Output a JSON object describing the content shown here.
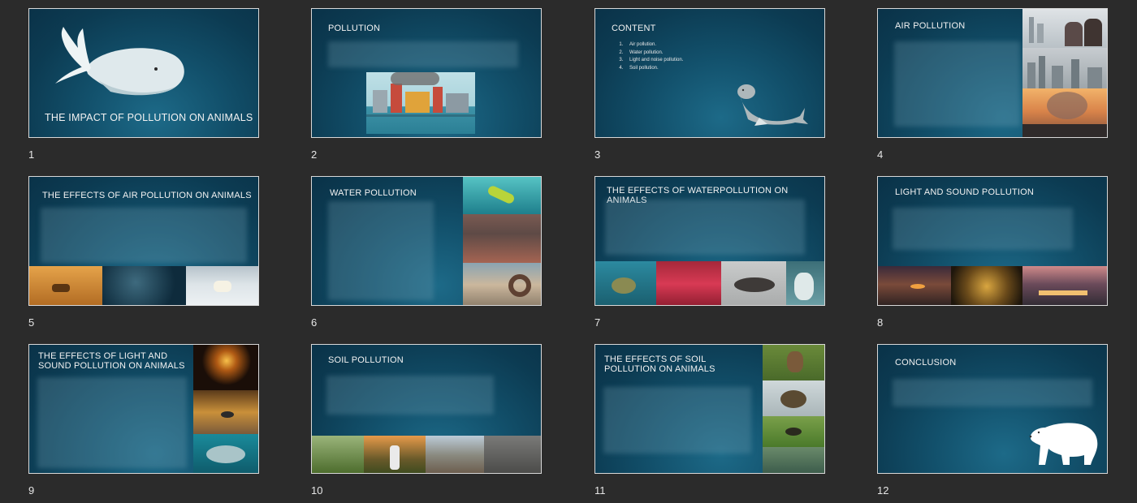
{
  "slides": [
    {
      "number": "1",
      "title": "THE IMPACT OF POLLUTION ON ANIMALS"
    },
    {
      "number": "2",
      "title": "POLLUTION"
    },
    {
      "number": "3",
      "title": "CONTENT",
      "items": [
        "Air pollution.",
        "Water pollution.",
        "Light and noise pollution.",
        "Soil pollution."
      ]
    },
    {
      "number": "4",
      "title": "AIR POLLUTION"
    },
    {
      "number": "5",
      "title": "THE EFFECTS OF AIR POLLUTION ON ANIMALS"
    },
    {
      "number": "6",
      "title": "WATER POLLUTION"
    },
    {
      "number": "7",
      "title": "THE EFFECTS OF WATERPOLLUTION ON ANIMALS"
    },
    {
      "number": "8",
      "title": "LIGHT AND SOUND POLLUTION"
    },
    {
      "number": "9",
      "title": "THE EFFECTS OF LIGHT AND SOUND POLLUTION ON ANIMALS"
    },
    {
      "number": "10",
      "title": "SOIL POLLUTION"
    },
    {
      "number": "11",
      "title": "THE EFFECTS OF SOIL POLLUTION ON ANIMALS"
    },
    {
      "number": "12",
      "title": "CONCLUSION"
    }
  ],
  "colors": {
    "background": "#2b2b2b",
    "slide_bg": "#0f4560",
    "slide_border": "#d8d8d8"
  },
  "icons": {
    "slide1": "whale-icon",
    "slide3": "seal-icon",
    "slide12": "polar-bear-icon"
  }
}
